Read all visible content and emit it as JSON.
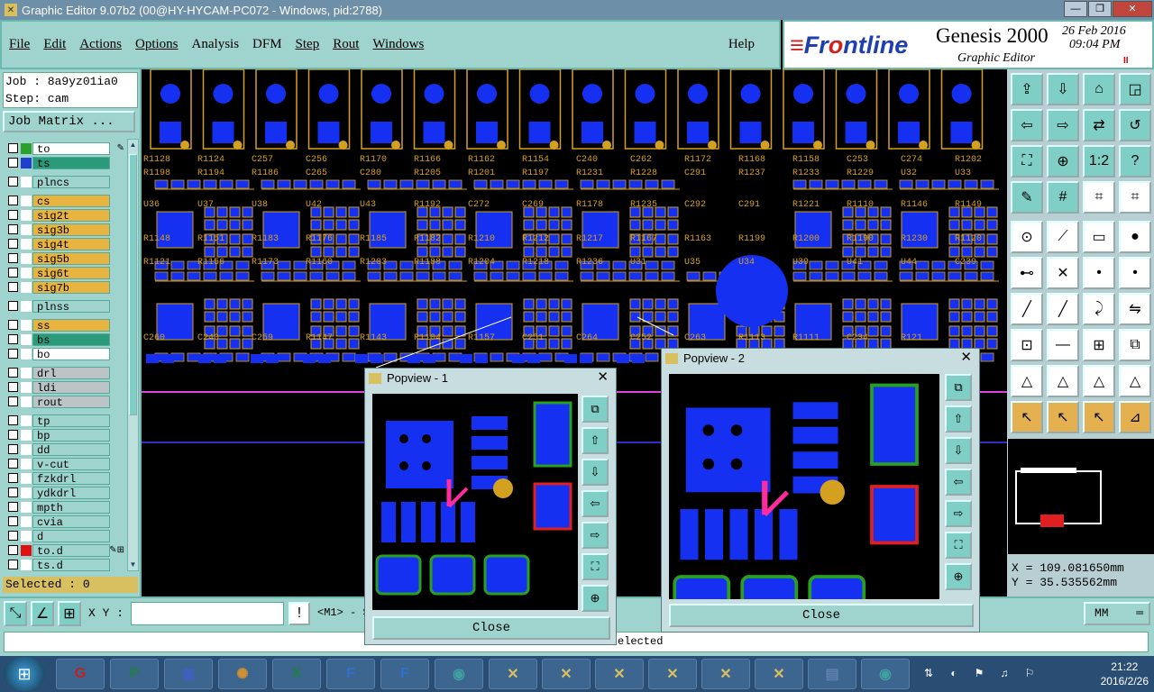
{
  "window": {
    "title": "Graphic Editor 9.07b2 (00@HY-HYCAM-PC072 - Windows, pid:2788)",
    "min": "—",
    "max": "❐",
    "close": "✕"
  },
  "menu": {
    "items": [
      "File",
      "Edit",
      "Actions",
      "Options",
      "Analysis",
      "DFM",
      "Step",
      "Rout",
      "Windows"
    ],
    "help": "Help"
  },
  "brand": {
    "logo_front": "Fr",
    "logo_o": "o",
    "logo_rest": "ntline",
    "product": "Genesis 2000",
    "subtitle": "Graphic Editor",
    "date": "26 Feb 2016",
    "time": "09:04 PM",
    "pause": "II"
  },
  "job": {
    "job_line": "Job : 8a9yz01ia0",
    "step_line": "Step: cam",
    "matrix_button": "Job Matrix ..."
  },
  "layers": [
    {
      "name": "to",
      "color": "#ffffff",
      "swatch": "#2ca02c",
      "edit": "✎"
    },
    {
      "name": "ts",
      "color": "#2a9a7a",
      "swatch": "#1f3fd0"
    },
    {
      "name": "plncs",
      "color": "#9fd3cd",
      "swatch": "#ffffff"
    },
    {
      "name": "cs",
      "color": "#e8b33e",
      "swatch": "#ffffff"
    },
    {
      "name": "sig2t",
      "color": "#e8b33e",
      "swatch": "#ffffff"
    },
    {
      "name": "sig3b",
      "color": "#e8b33e",
      "swatch": "#ffffff"
    },
    {
      "name": "sig4t",
      "color": "#e8b33e",
      "swatch": "#ffffff"
    },
    {
      "name": "sig5b",
      "color": "#e8b33e",
      "swatch": "#ffffff"
    },
    {
      "name": "sig6t",
      "color": "#e8b33e",
      "swatch": "#ffffff"
    },
    {
      "name": "sig7b",
      "color": "#e8b33e",
      "swatch": "#ffffff"
    },
    {
      "name": "plnss",
      "color": "#9fd3cd",
      "swatch": "#ffffff"
    },
    {
      "name": "ss",
      "color": "#e8b33e",
      "swatch": "#ffffff"
    },
    {
      "name": "bs",
      "color": "#2a9a7a",
      "swatch": "#ffffff"
    },
    {
      "name": "bo",
      "color": "#ffffff",
      "swatch": "#ffffff"
    },
    {
      "name": "drl",
      "color": "#bcc4c8",
      "swatch": "#ffffff"
    },
    {
      "name": "ldi",
      "color": "#bcc4c8",
      "swatch": "#ffffff"
    },
    {
      "name": "rout",
      "color": "#bcc4c8",
      "swatch": "#ffffff"
    },
    {
      "name": "tp",
      "color": "#9fd3cd",
      "swatch": "#ffffff"
    },
    {
      "name": "bp",
      "color": "#9fd3cd",
      "swatch": "#ffffff"
    },
    {
      "name": "dd",
      "color": "#9fd3cd",
      "swatch": "#ffffff"
    },
    {
      "name": "v-cut",
      "color": "#9fd3cd",
      "swatch": "#ffffff"
    },
    {
      "name": "fzkdrl",
      "color": "#9fd3cd",
      "swatch": "#ffffff"
    },
    {
      "name": "ydkdrl",
      "color": "#9fd3cd",
      "swatch": "#ffffff"
    },
    {
      "name": "mpth",
      "color": "#9fd3cd",
      "swatch": "#ffffff"
    },
    {
      "name": "cvia",
      "color": "#9fd3cd",
      "swatch": "#ffffff"
    },
    {
      "name": "d",
      "color": "#9fd3cd",
      "swatch": "#ffffff"
    },
    {
      "name": "to.d",
      "color": "#9fd3cd",
      "swatch": "#e01010",
      "edit": "✎⊞"
    },
    {
      "name": "ts.d",
      "color": "#9fd3cd",
      "swatch": "#ffffff"
    }
  ],
  "selected": "Selected : 0",
  "coords": {
    "x": "X = 109.081650mm",
    "y": "Y =  35.535562mm"
  },
  "bottom": {
    "xy_label": "X Y :",
    "xy_value": "",
    "info": "!",
    "mode": "<M1> - S",
    "units": "MM",
    "units_icon": "═",
    "status_text": "elected"
  },
  "popups": [
    {
      "title": "Popview - 1",
      "close_label": "Close",
      "close_x": "✕"
    },
    {
      "title": "Popview - 2",
      "close_label": "Close",
      "close_x": "✕"
    }
  ],
  "canvas_labels": [
    "R1128",
    "R1124",
    "C257",
    "C256",
    "R1170",
    "R1166",
    "R1162",
    "R1154",
    "C240",
    "C262",
    "R1172",
    "R1168",
    "R1158",
    "C253",
    "C274",
    "R1202",
    "R1198",
    "R1194",
    "R1186",
    "C265",
    "C280",
    "R1205",
    "R1201",
    "R1197",
    "R1231",
    "R1228",
    "C291",
    "R1237",
    "R1233",
    "R1229",
    "U32",
    "U33",
    "U36",
    "U37",
    "U38",
    "U42",
    "U43",
    "R1192",
    "C272",
    "C269",
    "R1178",
    "R1235",
    "C292",
    "C291",
    "R1221",
    "R1110",
    "R1146",
    "R1149",
    "R1148",
    "R1151",
    "R1183",
    "R1176",
    "R1185",
    "R1182",
    "R1210",
    "R1212",
    "R1217",
    "R1167",
    "R1163",
    "R1199",
    "R1200",
    "R1190",
    "R1230",
    "R1120",
    "R1121",
    "R1156",
    "R1173",
    "R1160",
    "R1203",
    "R1188",
    "R1204",
    "R1218",
    "R1236",
    "U31",
    "U35",
    "U34",
    "U39",
    "U41",
    "U44",
    "C239",
    "C260",
    "C240",
    "C259",
    "R1147",
    "R1143",
    "R1104",
    "R1157",
    "C251",
    "C264",
    "C252",
    "C263",
    "R1113",
    "R1111",
    "C234",
    "R121"
  ],
  "taskbar": {
    "clock_time": "21:22",
    "clock_date": "2016/2/26"
  },
  "colors": {
    "panel": "#9fd3cd",
    "pad": "#1530f0",
    "trace": "#d4a020",
    "magenta": "#e040e0"
  }
}
